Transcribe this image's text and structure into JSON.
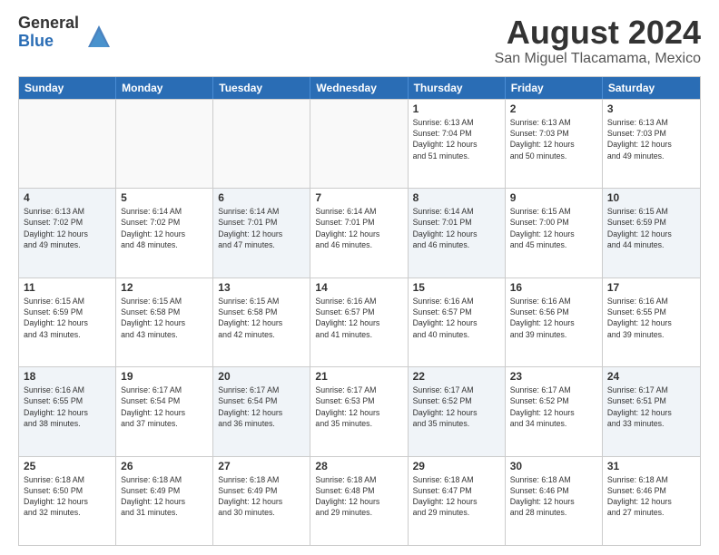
{
  "logo": {
    "general": "General",
    "blue": "Blue"
  },
  "title": "August 2024",
  "subtitle": "San Miguel Tlacamama, Mexico",
  "header_days": [
    "Sunday",
    "Monday",
    "Tuesday",
    "Wednesday",
    "Thursday",
    "Friday",
    "Saturday"
  ],
  "weeks": [
    [
      {
        "day": "",
        "info": ""
      },
      {
        "day": "",
        "info": ""
      },
      {
        "day": "",
        "info": ""
      },
      {
        "day": "",
        "info": ""
      },
      {
        "day": "1",
        "info": "Sunrise: 6:13 AM\nSunset: 7:04 PM\nDaylight: 12 hours\nand 51 minutes."
      },
      {
        "day": "2",
        "info": "Sunrise: 6:13 AM\nSunset: 7:03 PM\nDaylight: 12 hours\nand 50 minutes."
      },
      {
        "day": "3",
        "info": "Sunrise: 6:13 AM\nSunset: 7:03 PM\nDaylight: 12 hours\nand 49 minutes."
      }
    ],
    [
      {
        "day": "4",
        "info": "Sunrise: 6:13 AM\nSunset: 7:02 PM\nDaylight: 12 hours\nand 49 minutes."
      },
      {
        "day": "5",
        "info": "Sunrise: 6:14 AM\nSunset: 7:02 PM\nDaylight: 12 hours\nand 48 minutes."
      },
      {
        "day": "6",
        "info": "Sunrise: 6:14 AM\nSunset: 7:01 PM\nDaylight: 12 hours\nand 47 minutes."
      },
      {
        "day": "7",
        "info": "Sunrise: 6:14 AM\nSunset: 7:01 PM\nDaylight: 12 hours\nand 46 minutes."
      },
      {
        "day": "8",
        "info": "Sunrise: 6:14 AM\nSunset: 7:01 PM\nDaylight: 12 hours\nand 46 minutes."
      },
      {
        "day": "9",
        "info": "Sunrise: 6:15 AM\nSunset: 7:00 PM\nDaylight: 12 hours\nand 45 minutes."
      },
      {
        "day": "10",
        "info": "Sunrise: 6:15 AM\nSunset: 6:59 PM\nDaylight: 12 hours\nand 44 minutes."
      }
    ],
    [
      {
        "day": "11",
        "info": "Sunrise: 6:15 AM\nSunset: 6:59 PM\nDaylight: 12 hours\nand 43 minutes."
      },
      {
        "day": "12",
        "info": "Sunrise: 6:15 AM\nSunset: 6:58 PM\nDaylight: 12 hours\nand 43 minutes."
      },
      {
        "day": "13",
        "info": "Sunrise: 6:15 AM\nSunset: 6:58 PM\nDaylight: 12 hours\nand 42 minutes."
      },
      {
        "day": "14",
        "info": "Sunrise: 6:16 AM\nSunset: 6:57 PM\nDaylight: 12 hours\nand 41 minutes."
      },
      {
        "day": "15",
        "info": "Sunrise: 6:16 AM\nSunset: 6:57 PM\nDaylight: 12 hours\nand 40 minutes."
      },
      {
        "day": "16",
        "info": "Sunrise: 6:16 AM\nSunset: 6:56 PM\nDaylight: 12 hours\nand 39 minutes."
      },
      {
        "day": "17",
        "info": "Sunrise: 6:16 AM\nSunset: 6:55 PM\nDaylight: 12 hours\nand 39 minutes."
      }
    ],
    [
      {
        "day": "18",
        "info": "Sunrise: 6:16 AM\nSunset: 6:55 PM\nDaylight: 12 hours\nand 38 minutes."
      },
      {
        "day": "19",
        "info": "Sunrise: 6:17 AM\nSunset: 6:54 PM\nDaylight: 12 hours\nand 37 minutes."
      },
      {
        "day": "20",
        "info": "Sunrise: 6:17 AM\nSunset: 6:54 PM\nDaylight: 12 hours\nand 36 minutes."
      },
      {
        "day": "21",
        "info": "Sunrise: 6:17 AM\nSunset: 6:53 PM\nDaylight: 12 hours\nand 35 minutes."
      },
      {
        "day": "22",
        "info": "Sunrise: 6:17 AM\nSunset: 6:52 PM\nDaylight: 12 hours\nand 35 minutes."
      },
      {
        "day": "23",
        "info": "Sunrise: 6:17 AM\nSunset: 6:52 PM\nDaylight: 12 hours\nand 34 minutes."
      },
      {
        "day": "24",
        "info": "Sunrise: 6:17 AM\nSunset: 6:51 PM\nDaylight: 12 hours\nand 33 minutes."
      }
    ],
    [
      {
        "day": "25",
        "info": "Sunrise: 6:18 AM\nSunset: 6:50 PM\nDaylight: 12 hours\nand 32 minutes."
      },
      {
        "day": "26",
        "info": "Sunrise: 6:18 AM\nSunset: 6:49 PM\nDaylight: 12 hours\nand 31 minutes."
      },
      {
        "day": "27",
        "info": "Sunrise: 6:18 AM\nSunset: 6:49 PM\nDaylight: 12 hours\nand 30 minutes."
      },
      {
        "day": "28",
        "info": "Sunrise: 6:18 AM\nSunset: 6:48 PM\nDaylight: 12 hours\nand 29 minutes."
      },
      {
        "day": "29",
        "info": "Sunrise: 6:18 AM\nSunset: 6:47 PM\nDaylight: 12 hours\nand 29 minutes."
      },
      {
        "day": "30",
        "info": "Sunrise: 6:18 AM\nSunset: 6:46 PM\nDaylight: 12 hours\nand 28 minutes."
      },
      {
        "day": "31",
        "info": "Sunrise: 6:18 AM\nSunset: 6:46 PM\nDaylight: 12 hours\nand 27 minutes."
      }
    ]
  ]
}
